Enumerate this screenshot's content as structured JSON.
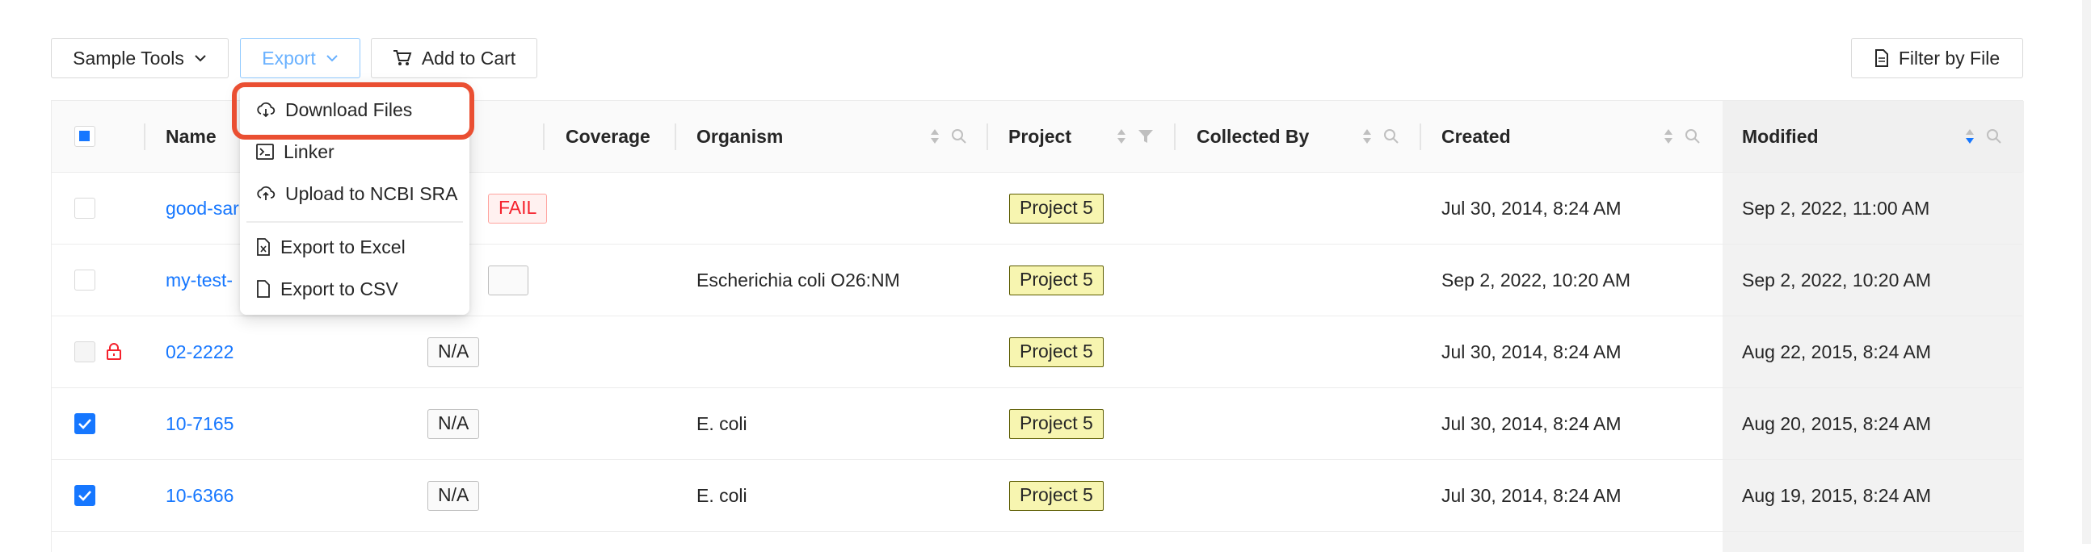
{
  "toolbar": {
    "sample_tools_label": "Sample Tools",
    "export_label": "Export",
    "add_to_cart_label": "Add to Cart",
    "filter_by_file_label": "Filter by File"
  },
  "export_menu": {
    "items": [
      {
        "label": "Download Files",
        "icon": "cloud-download-icon",
        "highlighted": true
      },
      {
        "label": "Linker",
        "icon": "terminal-icon"
      },
      {
        "label": "Upload to NCBI SRA",
        "icon": "cloud-upload-icon"
      },
      {
        "label": "Export to Excel",
        "icon": "excel-file-icon"
      },
      {
        "label": "Export to CSV",
        "icon": "file-icon"
      }
    ]
  },
  "table": {
    "columns": {
      "name": "Name",
      "coverage": "Coverage",
      "organism": "Organism",
      "project": "Project",
      "collected_by": "Collected By",
      "created": "Created",
      "modified": "Modified"
    },
    "rows": [
      {
        "checked": false,
        "locked": false,
        "name": "good-sar",
        "qc": "FAIL",
        "organism": "",
        "project": "Project 5",
        "created": "Jul 30, 2014, 8:24 AM",
        "modified": "Sep 2, 2022, 11:00 AM"
      },
      {
        "checked": false,
        "locked": false,
        "name": "my-test-",
        "qc": "",
        "organism": "Escherichia coli O26:NM",
        "project": "Project 5",
        "created": "Sep 2, 2022, 10:20 AM",
        "modified": "Sep 2, 2022, 10:20 AM"
      },
      {
        "checked": false,
        "locked": true,
        "name": "02-2222",
        "qc": "N/A",
        "organism": "",
        "project": "Project 5",
        "created": "Jul 30, 2014, 8:24 AM",
        "modified": "Aug 22, 2015, 8:24 AM"
      },
      {
        "checked": true,
        "locked": false,
        "name": "10-7165",
        "qc": "N/A",
        "organism": "E. coli",
        "project": "Project 5",
        "created": "Jul 30, 2014, 8:24 AM",
        "modified": "Aug 20, 2015, 8:24 AM"
      },
      {
        "checked": true,
        "locked": false,
        "name": "10-6366",
        "qc": "N/A",
        "organism": "E. coli",
        "project": "Project 5",
        "created": "Jul 30, 2014, 8:24 AM",
        "modified": "Aug 19, 2015, 8:24 AM"
      }
    ]
  },
  "colors": {
    "link": "#1677ff",
    "highlight": "#ea4f32",
    "project_tag_bg": "#f7f5b0",
    "fail_red": "#f5222d"
  }
}
